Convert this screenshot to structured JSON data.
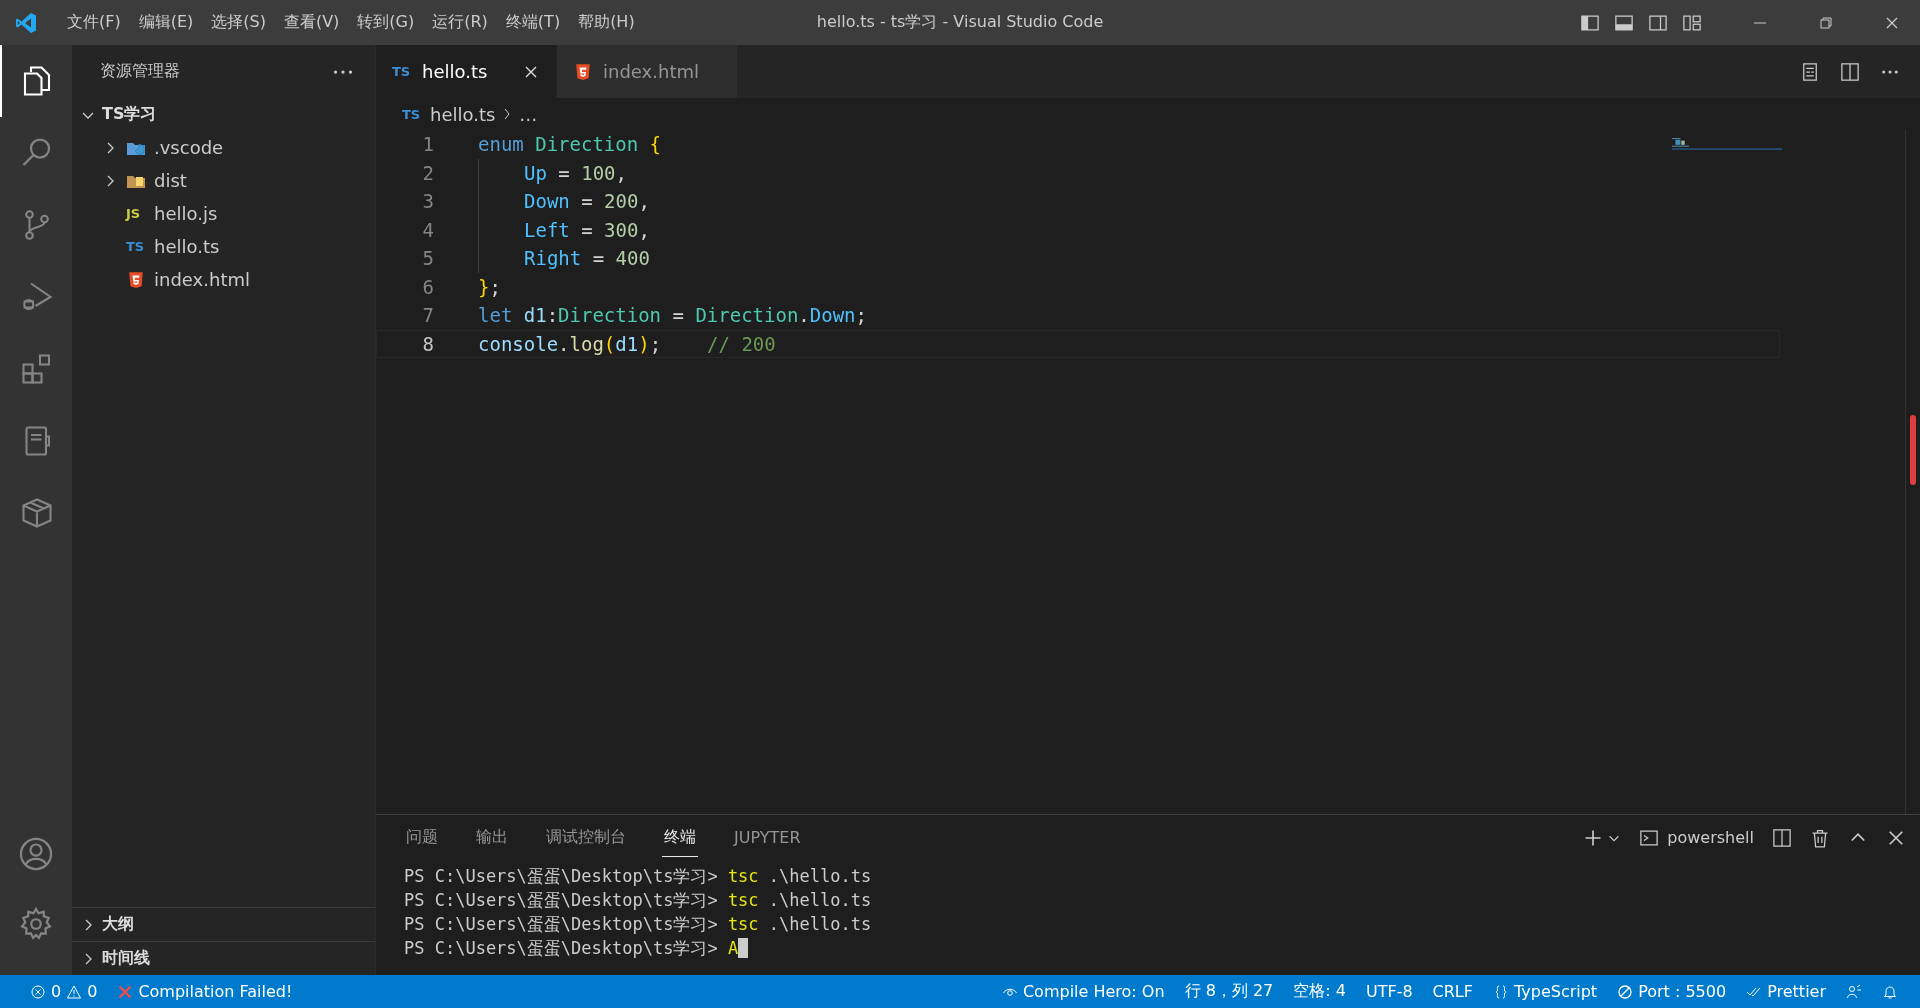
{
  "title_bar": {
    "menus": [
      "文件(F)",
      "编辑(E)",
      "选择(S)",
      "查看(V)",
      "转到(G)",
      "运行(R)",
      "终端(T)",
      "帮助(H)"
    ],
    "title": "hello.ts - ts学习 - Visual Studio Code"
  },
  "activity_bar": [
    {
      "kind": "files",
      "selected": true
    },
    {
      "kind": "search",
      "selected": false
    },
    {
      "kind": "source",
      "selected": false
    },
    {
      "kind": "debug",
      "selected": false
    },
    {
      "kind": "extensions",
      "selected": false
    },
    {
      "kind": "notebook",
      "selected": false
    },
    {
      "kind": "package",
      "selected": false
    }
  ],
  "explorer": {
    "title": "资源管理器",
    "root": {
      "label": "TS学习",
      "expanded": true,
      "children": [
        {
          "label": ".vscode",
          "kind": "vscode-folder",
          "expanded": false
        },
        {
          "label": "dist",
          "kind": "folder",
          "expanded": false
        },
        {
          "label": "hello.js",
          "kind": "js",
          "badge": "JS"
        },
        {
          "label": "hello.ts",
          "kind": "ts",
          "badge": "TS"
        },
        {
          "label": "index.html",
          "kind": "html"
        }
      ]
    },
    "sections": [
      {
        "label": "大纲",
        "expanded": false
      },
      {
        "label": "时间线",
        "expanded": false
      }
    ]
  },
  "tabs": [
    {
      "label": "hello.ts",
      "kind": "ts",
      "badge": "TS",
      "selected": true
    },
    {
      "label": "index.html",
      "kind": "html",
      "selected": false
    }
  ],
  "breadcrumb": {
    "badge": "TS",
    "file": "hello.ts",
    "rest": "…"
  },
  "editor": {
    "lines": [
      {
        "number": "1",
        "current": false,
        "indented": false,
        "tokens": [
          {
            "text": "enum",
            "kind": "kw"
          },
          {
            "text": " Direction",
            "kind": "type"
          },
          {
            "text": " {",
            "kind": "brace"
          }
        ]
      },
      {
        "number": "2",
        "current": false,
        "indented": true,
        "tokens": [
          {
            "text": "Up",
            "kind": "prop"
          },
          {
            "text": " = ",
            "kind": "punct"
          },
          {
            "text": "100",
            "kind": "num"
          },
          {
            "text": ",",
            "kind": "punct"
          }
        ]
      },
      {
        "number": "3",
        "current": false,
        "indented": true,
        "tokens": [
          {
            "text": "Down",
            "kind": "prop"
          },
          {
            "text": " = ",
            "kind": "punct"
          },
          {
            "text": "200",
            "kind": "num"
          },
          {
            "text": ",",
            "kind": "punct"
          }
        ]
      },
      {
        "number": "4",
        "current": false,
        "indented": true,
        "tokens": [
          {
            "text": "Left",
            "kind": "prop"
          },
          {
            "text": " = ",
            "kind": "punct"
          },
          {
            "text": "300",
            "kind": "num"
          },
          {
            "text": ",",
            "kind": "punct"
          }
        ]
      },
      {
        "number": "5",
        "current": false,
        "indented": true,
        "tokens": [
          {
            "text": "Right",
            "kind": "prop"
          },
          {
            "text": " = ",
            "kind": "punct"
          },
          {
            "text": "400",
            "kind": "num"
          }
        ]
      },
      {
        "number": "6",
        "current": false,
        "indented": false,
        "tokens": [
          {
            "text": "}",
            "kind": "brace"
          },
          {
            "text": ";",
            "kind": "punct"
          }
        ]
      },
      {
        "number": "7",
        "current": false,
        "indented": false,
        "tokens": [
          {
            "text": "let",
            "kind": "kw"
          },
          {
            "text": " d1",
            "kind": "var"
          },
          {
            "text": ":",
            "kind": "punct"
          },
          {
            "text": "Direction",
            "kind": "type"
          },
          {
            "text": " = ",
            "kind": "punct"
          },
          {
            "text": "Direction",
            "kind": "type"
          },
          {
            "text": ".",
            "kind": "punct"
          },
          {
            "text": "Down",
            "kind": "prop"
          },
          {
            "text": ";",
            "kind": "punct"
          }
        ]
      },
      {
        "number": "8",
        "current": true,
        "indented": false,
        "tokens": [
          {
            "text": "console",
            "kind": "var"
          },
          {
            "text": ".",
            "kind": "punct"
          },
          {
            "text": "log",
            "kind": "fn"
          },
          {
            "text": "(",
            "kind": "brace"
          },
          {
            "text": "d1",
            "kind": "var"
          },
          {
            "text": ")",
            "kind": "brace"
          },
          {
            "text": ";",
            "kind": "punct"
          },
          {
            "text": "// 200",
            "kind": "comment"
          }
        ]
      }
    ]
  },
  "panel": {
    "tabs": [
      {
        "label": "问题",
        "selected": false
      },
      {
        "label": "输出",
        "selected": false
      },
      {
        "label": "调试控制台",
        "selected": false
      },
      {
        "label": "终端",
        "selected": true
      },
      {
        "label": "JUPYTER",
        "selected": false
      }
    ],
    "shell": "powershell",
    "terminal": [
      {
        "prompt": "PS C:\\Users\\蛋蛋\\Desktop\\ts学习>",
        "command": "tsc",
        "args": ".\\hello.ts"
      },
      {
        "prompt": "PS C:\\Users\\蛋蛋\\Desktop\\ts学习>",
        "command": "tsc",
        "args": ".\\hello.ts"
      },
      {
        "prompt": "PS C:\\Users\\蛋蛋\\Desktop\\ts学习>",
        "command": "tsc",
        "args": ".\\hello.ts"
      },
      {
        "prompt": "PS C:\\Users\\蛋蛋\\Desktop\\ts学习>",
        "command": "A"
      }
    ]
  },
  "status_bar": {
    "errors": "0",
    "warnings": "0",
    "message": "Compilation Failed!",
    "right": [
      {
        "kind": "eye",
        "text": "Compile Hero: On"
      },
      {
        "kind": "plain",
        "text": "行 8，列 27"
      },
      {
        "kind": "plain",
        "text": "空格: 4"
      },
      {
        "kind": "plain",
        "text": "UTF-8"
      },
      {
        "kind": "plain",
        "text": "CRLF"
      },
      {
        "kind": "braces",
        "text": "TypeScript"
      },
      {
        "kind": "port",
        "text": "Port : 5500"
      },
      {
        "kind": "checks",
        "text": "Prettier"
      },
      {
        "kind": "feedback"
      },
      {
        "kind": "bell"
      }
    ]
  }
}
